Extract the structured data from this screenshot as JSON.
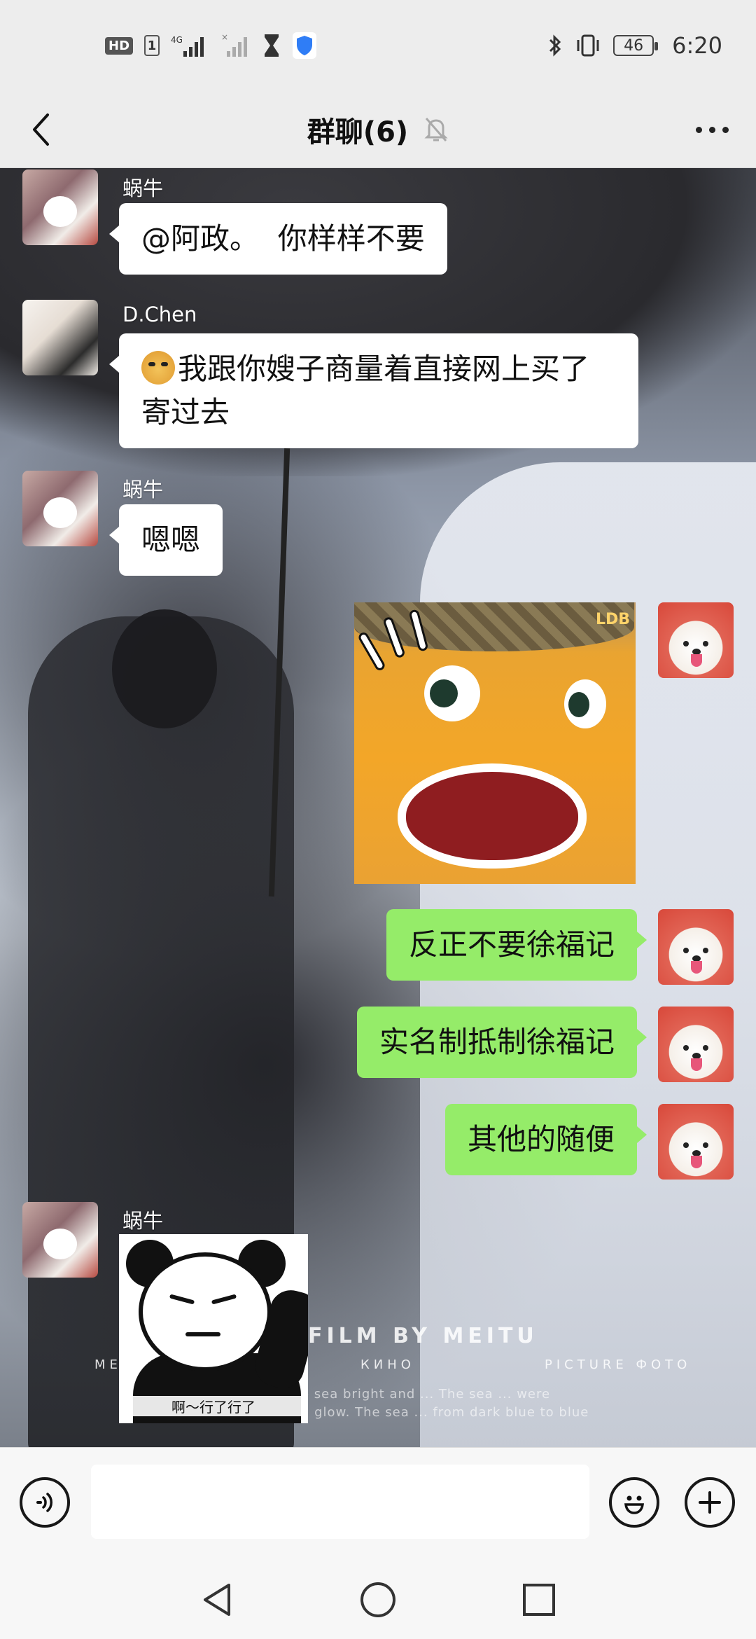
{
  "status_bar": {
    "hd_badge": "HD",
    "sim_slot": "1",
    "network_type": "4G",
    "battery_level": "46",
    "time": "6:20"
  },
  "title_bar": {
    "title": "群聊(6)",
    "back_icon": "back-chevron-icon",
    "mute_icon": "bell-off-icon",
    "more_icon": "more-dots-icon"
  },
  "messages": [
    {
      "side": "left",
      "sender": "蜗牛",
      "avatar": "snail-avatar",
      "text": "@阿政。  你样样不要"
    },
    {
      "side": "left",
      "sender": "D.Chen",
      "avatar": "couple-avatar",
      "emoji": "doge-emoji",
      "text": "我跟你嫂子商量着直接网上买了寄过去"
    },
    {
      "side": "left",
      "sender": "蜗牛",
      "avatar": "snail-avatar",
      "text": "嗯嗯"
    },
    {
      "side": "right",
      "type": "sticker",
      "sticker": "orange-monster-sticker",
      "sticker_text": "LDB",
      "avatar": "dog-avatar"
    },
    {
      "side": "right",
      "avatar": "dog-avatar",
      "text": "反正不要徐福记"
    },
    {
      "side": "right",
      "avatar": "dog-avatar",
      "text": "实名制抵制徐福记"
    },
    {
      "side": "right",
      "avatar": "dog-avatar",
      "text": "其他的随便"
    },
    {
      "side": "left",
      "sender": "蜗牛",
      "avatar": "snail-avatar",
      "type": "sticker",
      "sticker": "panda-meme-sticker",
      "sticker_text": "啊～行了行了"
    }
  ],
  "background_text": {
    "film": "FILM BY MEITU",
    "kino": "КИНО",
    "picture": "PICTURE ФОТО",
    "left_fragment": "ME",
    "caption_line1": "e sea bright and ... The sea ... were",
    "caption_line2": "n glow. The sea ... from dark blue to blue"
  },
  "input_bar": {
    "voice_icon": "voice-icon",
    "input_value": "",
    "emoji_icon": "smiley-icon",
    "plus_icon": "plus-icon"
  },
  "nav_bar": {
    "back": "nav-back-icon",
    "home": "nav-home-icon",
    "recent": "nav-recent-icon"
  }
}
